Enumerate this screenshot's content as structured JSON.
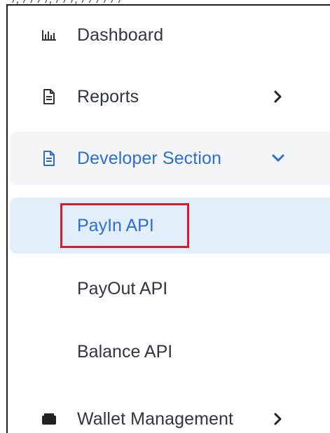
{
  "top_fragment": "/, / / / /, / / /, / / / / / /",
  "menu": {
    "dashboard": {
      "label": "Dashboard",
      "icon": "bar-chart-icon"
    },
    "reports": {
      "label": "Reports",
      "icon": "document-icon",
      "chevron": "chevron-right-icon"
    },
    "developer_section": {
      "label": "Developer Section",
      "icon": "document-icon",
      "chevron": "chevron-down-icon",
      "expanded": true,
      "sub_items": [
        {
          "label": "PayIn API",
          "active": true,
          "annotated": true
        },
        {
          "label": "PayOut API",
          "active": false
        },
        {
          "label": "Balance API",
          "active": false
        }
      ]
    },
    "wallet_management": {
      "label": "Wallet Management",
      "icon": "wallet-icon",
      "chevron": "chevron-right-icon"
    }
  },
  "colors": {
    "accent": "#2b6fd6",
    "active_background": "#e3eefb",
    "section_background": "#f4f5f7",
    "highlight_border": "#d61f2c",
    "text": "#303642"
  }
}
